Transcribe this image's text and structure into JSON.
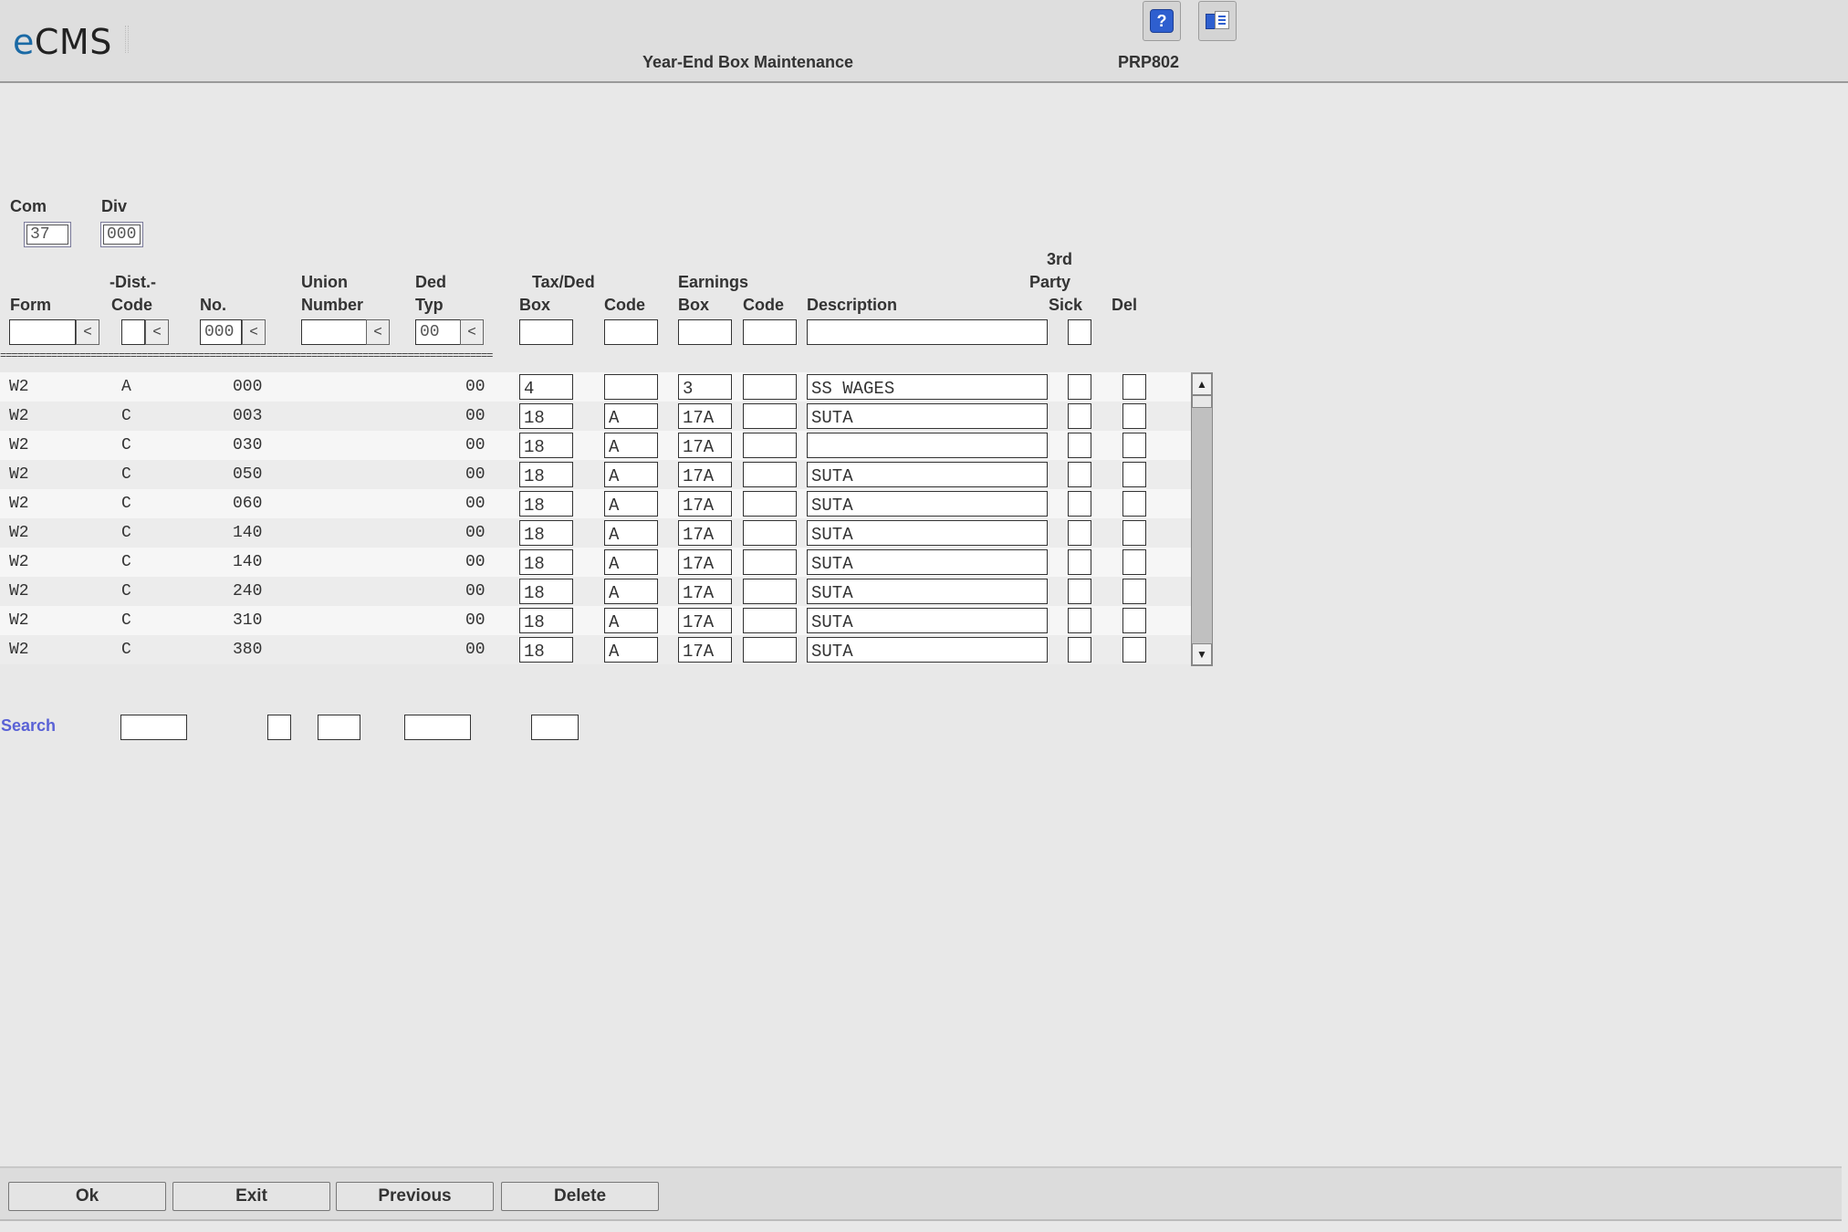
{
  "app": {
    "logo_e": "e",
    "logo_rest": "CMS",
    "title": "Year-End Box Maintenance",
    "program": "PRP802"
  },
  "header_buttons": {
    "help": "?"
  },
  "filters": {
    "com_label": "Com",
    "com_value": "37",
    "div_label": "Div",
    "div_value": "000"
  },
  "columns": {
    "form": "Form",
    "dist_top": "-Dist.-",
    "dist_code": "Code",
    "dist_no": "No.",
    "union_top": "Union",
    "union_bottom": "Number",
    "ded_top": "Ded",
    "ded_bottom": "Typ",
    "taxded_top": "Tax/Ded",
    "taxded_box": "Box",
    "taxded_code": "Code",
    "earn_top": "Earnings",
    "earn_box": "Box",
    "earn_code": "Code",
    "description": "Description",
    "sick_top1": "3rd",
    "sick_top2": "Party",
    "sick_bottom": "Sick",
    "del": "Del"
  },
  "header_inputs": {
    "dist_no": "000",
    "ded_typ": "00",
    "lookup": "<"
  },
  "separator": "=======================================================================================",
  "rows": [
    {
      "form": "W2",
      "dist_code": "A",
      "dist_no": "000",
      "ded": "00",
      "tax_box": "4",
      "tax_code": "",
      "earn_box": "3",
      "earn_code": "",
      "desc": "SS WAGES"
    },
    {
      "form": "W2",
      "dist_code": "C",
      "dist_no": "003",
      "ded": "00",
      "tax_box": "18",
      "tax_code": "A",
      "earn_box": "17A",
      "earn_code": "",
      "desc": "SUTA"
    },
    {
      "form": "W2",
      "dist_code": "C",
      "dist_no": "030",
      "ded": "00",
      "tax_box": "18",
      "tax_code": "A",
      "earn_box": "17A",
      "earn_code": "",
      "desc": ""
    },
    {
      "form": "W2",
      "dist_code": "C",
      "dist_no": "050",
      "ded": "00",
      "tax_box": "18",
      "tax_code": "A",
      "earn_box": "17A",
      "earn_code": "",
      "desc": "SUTA"
    },
    {
      "form": "W2",
      "dist_code": "C",
      "dist_no": "060",
      "ded": "00",
      "tax_box": "18",
      "tax_code": "A",
      "earn_box": "17A",
      "earn_code": "",
      "desc": "SUTA"
    },
    {
      "form": "W2",
      "dist_code": "C",
      "dist_no": "140",
      "ded": "00",
      "tax_box": "18",
      "tax_code": "A",
      "earn_box": "17A",
      "earn_code": "",
      "desc": "SUTA"
    },
    {
      "form": "W2",
      "dist_code": "C",
      "dist_no": "140",
      "ded": "00",
      "tax_box": "18",
      "tax_code": "A",
      "earn_box": "17A",
      "earn_code": "",
      "desc": "SUTA"
    },
    {
      "form": "W2",
      "dist_code": "C",
      "dist_no": "240",
      "ded": "00",
      "tax_box": "18",
      "tax_code": "A",
      "earn_box": "17A",
      "earn_code": "",
      "desc": "SUTA"
    },
    {
      "form": "W2",
      "dist_code": "C",
      "dist_no": "310",
      "ded": "00",
      "tax_box": "18",
      "tax_code": "A",
      "earn_box": "17A",
      "earn_code": "",
      "desc": "SUTA"
    },
    {
      "form": "W2",
      "dist_code": "C",
      "dist_no": "380",
      "ded": "00",
      "tax_box": "18",
      "tax_code": "A",
      "earn_box": "17A",
      "earn_code": "",
      "desc": "SUTA"
    }
  ],
  "scrollbar": {
    "up": "▲",
    "down": "▼"
  },
  "search": {
    "label": "Search"
  },
  "footer": {
    "ok": "Ok",
    "exit": "Exit",
    "previous": "Previous",
    "delete": "Delete"
  }
}
